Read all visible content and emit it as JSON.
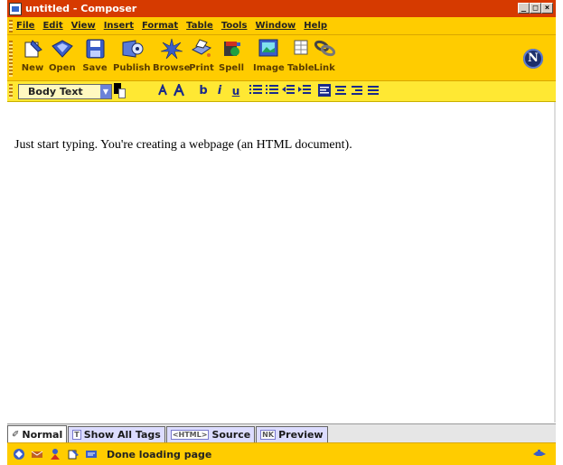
{
  "window": {
    "title": "untitled - Composer"
  },
  "menubar": {
    "items": [
      "File",
      "Edit",
      "View",
      "Insert",
      "Format",
      "Table",
      "Tools",
      "Window",
      "Help"
    ]
  },
  "toolbar": {
    "buttons": [
      {
        "label": "New",
        "icon": "new-page-icon"
      },
      {
        "label": "Open",
        "icon": "open-folder-icon"
      },
      {
        "label": "Save",
        "icon": "floppy-disk-icon"
      },
      {
        "label": "Publish",
        "icon": "publish-icon"
      },
      {
        "label": "Browse",
        "icon": "browse-icon"
      },
      {
        "label": "Print",
        "icon": "printer-icon"
      },
      {
        "label": "Spell",
        "icon": "spellcheck-icon"
      },
      {
        "label": "Image",
        "icon": "image-icon"
      },
      {
        "label": "Table",
        "icon": "table-icon"
      },
      {
        "label": "Link",
        "icon": "link-icon"
      }
    ],
    "brand_logo": "N"
  },
  "format": {
    "paragraph_style": "Body Text",
    "buttons": [
      "smaller-font-icon",
      "larger-font-icon",
      "bold-icon",
      "italic-icon",
      "underline-icon",
      "bulleted-list-icon",
      "numbered-list-icon",
      "outdent-icon",
      "indent-icon",
      "align-left-icon",
      "align-center-icon",
      "align-right-icon",
      "justify-icon"
    ],
    "bold_glyph": "b",
    "italic_glyph": "i",
    "underline_glyph": "u"
  },
  "content": {
    "text": "Just start typing. You're creating a webpage (an HTML document)."
  },
  "tabs": [
    {
      "label": "Normal",
      "icon_text": "✐",
      "active": true
    },
    {
      "label": "Show All Tags",
      "icon_text": "T",
      "active": false
    },
    {
      "label": "Source",
      "icon_text": "<HTML>",
      "active": false
    },
    {
      "label": "Preview",
      "icon_text": "NK",
      "active": false
    }
  ],
  "status": {
    "text": "Done loading page"
  },
  "colors": {
    "titlebar": "#d63a00",
    "toolbar": "#ffcc00",
    "format_bar": "#ffe833",
    "tab_bg": "#dcdcff"
  }
}
